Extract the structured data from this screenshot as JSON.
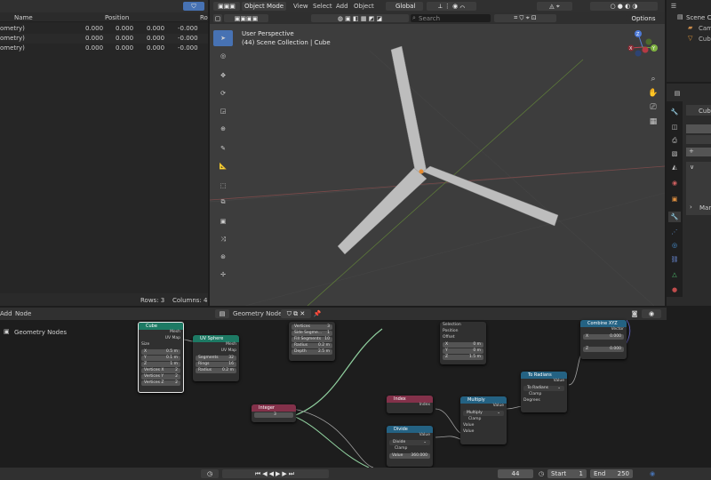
{
  "spreadsheet": {
    "columns": [
      "Name",
      "Position",
      "Ro"
    ],
    "rows": [
      {
        "name": "ometry)",
        "x": "0.000",
        "y": "0.000",
        "z": "0.000",
        "rot": "-0.000"
      },
      {
        "name": "ometry)",
        "x": "0.000",
        "y": "0.000",
        "z": "0.000",
        "rot": "-0.000"
      },
      {
        "name": "ometry)",
        "x": "0.000",
        "y": "0.000",
        "z": "0.000",
        "rot": "-0.000"
      }
    ],
    "rows_label": "Rows: 3",
    "columns_label": "Columns: 4"
  },
  "viewport": {
    "mode": "Object Mode",
    "menus": [
      "View",
      "Select",
      "Add",
      "Object"
    ],
    "orientation": "Global",
    "search_placeholder": "Search",
    "options": "Options",
    "perspective": "User Perspective",
    "collection": "(44) Scene Collection | Cube",
    "gizmo": {
      "z": "Z",
      "y": "Y",
      "x": "X"
    }
  },
  "outliner": {
    "title": "Scene Co",
    "items": [
      "Cam",
      "Cube"
    ]
  },
  "properties": {
    "object": "Cube",
    "truncated": "Man"
  },
  "node_editor": {
    "menus": [
      "Add",
      "Node"
    ],
    "tree_name": "Geometry Nodes",
    "tree_label": "Geometry Nodes",
    "nodes": {
      "cube": {
        "title": "Cube",
        "out1": "Mesh",
        "out2": "UV Map",
        "size": "Size",
        "x": "X",
        "xv": "0.5 m",
        "y": "Y",
        "yv": "0.1 m",
        "z": "Z",
        "zv": "1 m",
        "vx": "Vertices X",
        "vxv": "2",
        "vy": "Vertices Y",
        "vyv": "2",
        "vz": "Vertices Z",
        "vzv": "2"
      },
      "uvsphere": {
        "title": "UV Sphere",
        "out1": "Mesh",
        "out2": "UV Map",
        "seg": "Segments",
        "segv": "32",
        "rings": "Rings",
        "ringsv": "16",
        "rad": "Radius",
        "radv": "0.2 m"
      },
      "cone": {
        "vtx": "Vertices",
        "vtxv": "3",
        "side": "Side Segme...",
        "sidev": "1",
        "fill": "Fill Segments",
        "fillv": "10",
        "rad": "Radius",
        "radv": "0.2 m",
        "depth": "Depth",
        "depthv": "2.5 m"
      },
      "transform": {
        "sel": "Selection",
        "pos": "Position",
        "off": "Offset",
        "x": "X",
        "xv": "0 m",
        "y": "Y",
        "yv": "0 m",
        "z": "Z",
        "zv": "1.5 m"
      },
      "combine": {
        "title": "Combine XYZ",
        "out": "Vector",
        "x": "X",
        "xv": "0.000",
        "z": "Z",
        "zv": "0.000"
      },
      "integer": {
        "title": "Integer",
        "val": "3"
      },
      "index": {
        "title": "Index",
        "out": "Index"
      },
      "divide": {
        "title": "Divide",
        "out": "Value",
        "op": "Divide",
        "clamp": "Clamp",
        "val": "Value",
        "valv": "360.000"
      },
      "multiply": {
        "title": "Multiply",
        "out": "Value",
        "op": "Multiply",
        "clamp": "Clamp",
        "v1": "Value",
        "v2": "Value"
      },
      "radians": {
        "title": "To Radians",
        "out": "Value",
        "op": "To Radians",
        "clamp": "Clamp",
        "deg": "Degrees"
      }
    }
  },
  "timeline": {
    "frame": "44",
    "start_label": "Start",
    "start": "1",
    "end_label": "End",
    "end": "250"
  },
  "colors": {
    "accent": "#4772b3",
    "geo_header": "#1d7a64",
    "input_header": "#83314a",
    "util_header": "#246283"
  }
}
